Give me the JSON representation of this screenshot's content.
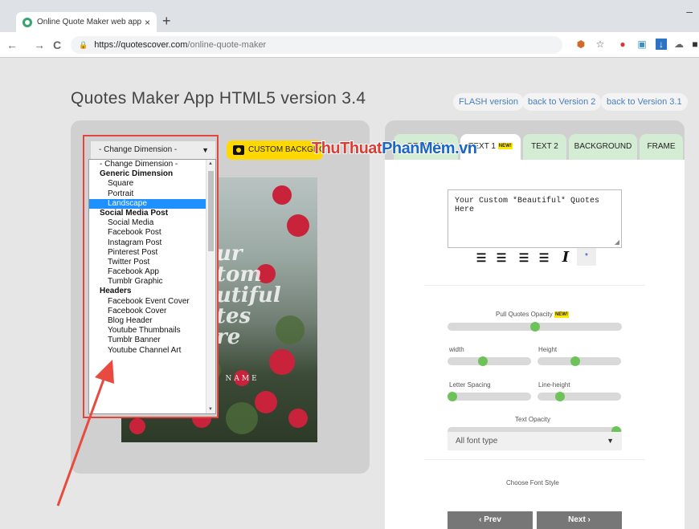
{
  "browser": {
    "tab_title": "Online Quote Maker web applica",
    "tab_close": "×",
    "new_tab": "+",
    "minimize": "–",
    "nav_back": "←",
    "nav_forward": "→",
    "nav_reload": "C",
    "url_host": "https://quotescover.com",
    "url_path": "/online-quote-maker",
    "extensions": [
      "shield-icon",
      "star-icon",
      "extension-icon",
      "screen-icon",
      "download-icon",
      "cloud-icon"
    ]
  },
  "page": {
    "title": "Quotes Maker App HTML5 version 3.4",
    "version_links": [
      "FLASH version",
      "back to Version 2",
      "back to Version 3.1"
    ]
  },
  "left": {
    "dimension_select": "- Change Dimension -",
    "custom_background": "CUSTOM BACKGROUND",
    "poster_text": "ur\ntom\nutiful\ntes\nre",
    "poster_name": "YOUR NAME",
    "dropdown_items": [
      {
        "label": "- Change Dimension -",
        "kind": "first"
      },
      {
        "label": "Generic Dimension",
        "kind": "group"
      },
      {
        "label": "Square",
        "kind": "item"
      },
      {
        "label": "Portrait",
        "kind": "item"
      },
      {
        "label": "Landscape",
        "kind": "selected"
      },
      {
        "label": "Social Media Post",
        "kind": "group"
      },
      {
        "label": "Social Media",
        "kind": "item"
      },
      {
        "label": "Facebook Post",
        "kind": "item"
      },
      {
        "label": "Instagram Post",
        "kind": "item"
      },
      {
        "label": "Pinterest Post",
        "kind": "item"
      },
      {
        "label": "Twitter Post",
        "kind": "item"
      },
      {
        "label": "Facebook App",
        "kind": "item"
      },
      {
        "label": "Tumblr Graphic",
        "kind": "item"
      },
      {
        "label": "Headers",
        "kind": "group"
      },
      {
        "label": "Facebook Event Cover",
        "kind": "item"
      },
      {
        "label": "Facebook Cover",
        "kind": "item"
      },
      {
        "label": "Blog Header",
        "kind": "item"
      },
      {
        "label": "Youtube Thumbnails",
        "kind": "item"
      },
      {
        "label": "Tumblr Banner",
        "kind": "item"
      },
      {
        "label": "Youtube Channel Art",
        "kind": "item"
      }
    ]
  },
  "watermark": {
    "part1": "ThuThuat",
    "part2": "PhanMem",
    "part3": ".vn"
  },
  "right": {
    "tabs": [
      {
        "label": "ORIGINAL",
        "badge": ""
      },
      {
        "label": "TEXT 1",
        "badge": "NEW!"
      },
      {
        "label": "TEXT 2",
        "badge": ""
      },
      {
        "label": "BACKGROUND",
        "badge": ""
      },
      {
        "label": "FRAME",
        "badge": ""
      }
    ],
    "quote_text": "Your Custom *Beautiful* Quotes Here",
    "star": "*",
    "pull_opacity_label": "Pull Quotes Opacity",
    "pull_opacity_badge": "NEW!",
    "pull_opacity": 0.5,
    "width_label": "width",
    "width_value": 0.42,
    "height_label": "Height",
    "height_value": 0.45,
    "letter_spacing_label": "Letter Spacing",
    "letter_spacing_value": 0.05,
    "line_height_label": "Line-height",
    "line_height_value": 0.27,
    "text_opacity_label": "Text Opacity",
    "text_opacity_value": 0.97,
    "font_style_label": "Choose Font Style",
    "font_select": "All font type",
    "prev_label": "‹ Prev",
    "next_label": "Next ›"
  }
}
